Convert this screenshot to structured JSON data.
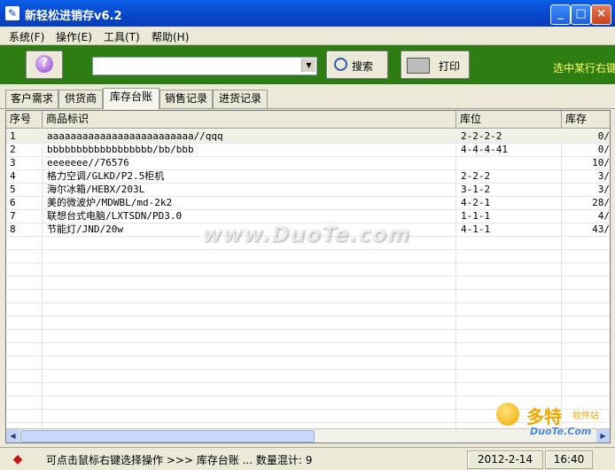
{
  "window": {
    "title": "新轻松进销存v6.2",
    "controls": {
      "minimize": "_",
      "maximize": "□",
      "close": "×"
    }
  },
  "menu": [
    {
      "label": "系统(F)"
    },
    {
      "label": "操作(E)"
    },
    {
      "label": "工具(T)"
    },
    {
      "label": "帮助(H)"
    }
  ],
  "toolbar": {
    "help_glyph": "?",
    "search_value": "",
    "search_label": "搜索",
    "print_label": "打印",
    "hint": "选中某行右键"
  },
  "tabs": [
    {
      "label": "客户需求",
      "active": false
    },
    {
      "label": "供货商",
      "active": false
    },
    {
      "label": "库存台账",
      "active": true
    },
    {
      "label": "销售记录",
      "active": false
    },
    {
      "label": "进货记录",
      "active": false
    }
  ],
  "table": {
    "columns": [
      "序号",
      "商品标识",
      "库位",
      "库存"
    ],
    "rows": [
      [
        "1",
        "aaaaaaaaaaaaaaaaaaaaaaaaa//qqq",
        "2-2-2-2",
        "0/"
      ],
      [
        "2",
        "bbbbbbbbbbbbbbbbbb/bb/bbb",
        "4-4-4-41",
        "0/"
      ],
      [
        "3",
        "eeeeeee//76576",
        "",
        "10/"
      ],
      [
        "4",
        "格力空调/GLKD/P2.5柜机",
        "2-2-2",
        "3/"
      ],
      [
        "5",
        "海尔冰箱/HEBX/203L",
        "3-1-2",
        "3/"
      ],
      [
        "6",
        "美的微波炉/MDWBL/md-2k2",
        "4-2-1",
        "28/"
      ],
      [
        "7",
        "联想台式电脑/LXTSDN/PD3.0",
        "1-1-1",
        "4/"
      ],
      [
        "8",
        "节能灯/JND/20w",
        "4-1-1",
        "43/"
      ]
    ]
  },
  "overlay": {
    "watermark": "www.DuoTe.com",
    "logo_big": "多特",
    "logo_small": "软件站",
    "logo_domain": "DuoTe.Com"
  },
  "status": {
    "message": "可点击鼠标右键选择操作 >>> 库存台账  ...   数量混计: 9",
    "date": "2012-2-14",
    "time": "16:40"
  }
}
